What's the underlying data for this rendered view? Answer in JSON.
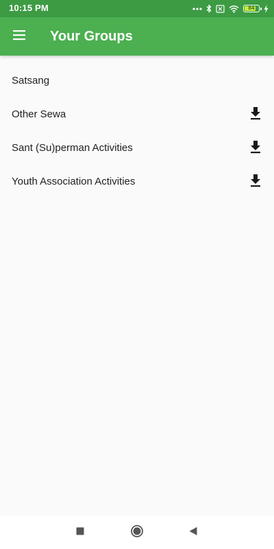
{
  "status_bar": {
    "time": "10:15 PM",
    "battery_level": "84",
    "battery_fraction": 0.84,
    "icons": [
      "more-dots-icon",
      "bluetooth-icon",
      "sim-off-icon",
      "wifi-icon",
      "battery-icon",
      "charging-icon"
    ]
  },
  "app_bar": {
    "menu_icon": "menu-icon",
    "title": "Your Groups"
  },
  "groups": [
    {
      "label": "Satsang",
      "download": false
    },
    {
      "label": "Other Sewa",
      "download": true
    },
    {
      "label": "Sant (Su)perman Activities",
      "download": true
    },
    {
      "label": "Youth Association Activities",
      "download": true
    }
  ],
  "nav_bar": {
    "buttons": [
      "recents-square-icon",
      "home-circle-icon",
      "back-triangle-icon"
    ]
  },
  "colors": {
    "status_bar": "#3d9b44",
    "app_bar": "#4caf50",
    "background": "#fafafa",
    "text": "#212121",
    "icon": "#1a1a1a",
    "nav_icon": "#555555"
  }
}
